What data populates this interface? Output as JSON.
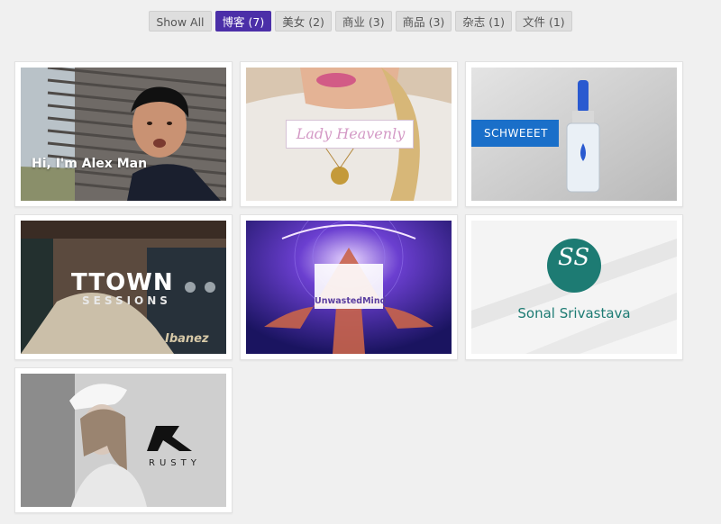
{
  "filters": [
    {
      "label": "Show All",
      "active": false
    },
    {
      "label": "博客 (7)",
      "active": true
    },
    {
      "label": "美女 (2)",
      "active": false
    },
    {
      "label": "商业 (3)",
      "active": false
    },
    {
      "label": "商品 (3)",
      "active": false
    },
    {
      "label": "杂志 (1)",
      "active": false
    },
    {
      "label": "文件 (1)",
      "active": false
    }
  ],
  "portfolio": {
    "items": [
      {
        "overlay": "Hi, I'm Alex Man"
      },
      {
        "overlay": "Lady Heavenly"
      },
      {
        "overlay": "SCHWEEET"
      },
      {
        "overlay": "TTOWN",
        "overlay2": "SESSIONS",
        "overlay3": "Ibanez"
      },
      {
        "overlay": "UnwastedMind"
      },
      {
        "overlay": "Sonal Srivastava",
        "monogram": "SS"
      },
      {
        "overlay": "RUSTY"
      }
    ]
  },
  "colors": {
    "active_filter": "#4b2fa8",
    "page_background": "#f0f0f0",
    "sonal_teal": "#1d7b73",
    "schweeet_blue": "#1a6fc9"
  }
}
